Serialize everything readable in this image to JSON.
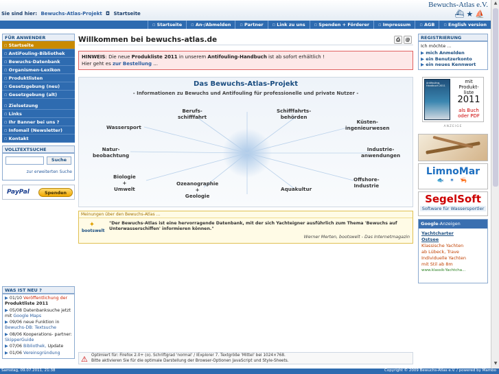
{
  "header": {
    "brand": "Bewuchs-Atlas e.V.",
    "breadcrumb_label": "Sie sind hier:",
    "breadcrumb_site": "Bewuchs-Atlas-Projekt",
    "breadcrumb_page": "Startseite"
  },
  "topnav": [
    "Startseite",
    "An-/Abmelden",
    "Partner",
    "Link zu uns",
    "Spenden + Förderer",
    "Impressum",
    "AGB",
    "English version"
  ],
  "left": {
    "heading": "FÜR ANWENDER",
    "menu": [
      "Startseite",
      "AntiFouling-Bibliothek",
      "Bewuchs-Datenbank",
      "Organismen-Lexikon",
      "Produktlisten",
      "Gesetzgebung (neu)",
      "Gesetzgebung (alt)",
      "Zielsetzung",
      "Links",
      "Ihr Banner bei uns ?",
      "Infomail (Newsletter)",
      "Kontakt"
    ],
    "search_heading": "VOLLTEXTSUCHE",
    "search_button": "Suche",
    "search_extended": "zur erweiterten Suche",
    "paypal_label": "PayPal",
    "paypal_button": "Spenden",
    "news_heading": "WAS IST NEU ?",
    "news": [
      {
        "date": "01/10",
        "text": "Veröffentlichung der",
        "bold": "Produktliste 2011"
      },
      {
        "date": "05/08",
        "text": "Datenbanksuche jetzt mit",
        "bold": "Google Maps"
      },
      {
        "date": "09/06",
        "text": "neue Funktion in",
        "bold": "Bewuchs-DB: Textsuche"
      },
      {
        "date": "08/06",
        "text": "Kooperations- partner:",
        "bold": "SkipperGuide"
      },
      {
        "date": "07/06",
        "text": "Bibliothek,",
        "bold": "Update"
      },
      {
        "date": "01/06",
        "text": "Vereinsgründung",
        "bold": ""
      }
    ]
  },
  "main": {
    "title": "Willkommen bei bewuchs-atlas.de",
    "hint_label": "HINWEIS",
    "hint_text1": ": Die neue ",
    "hint_bold1": "Produkliste 2011",
    "hint_text2": " in unserem ",
    "hint_bold2": "Antifouling-Handbuch",
    "hint_text3": " ist ab sofort erhältlich !",
    "hint_line2": "Hier geht es ",
    "hint_link": "zur Bestellung",
    "hint_after": " ...",
    "project_title": "Das Bewuchs-Atlas-Projekt",
    "project_sub": "- Informationen zu Bewuchs und Antifouling für professionelle und private Nutzer -",
    "nodes": [
      [
        "Berufs-",
        "schifffahrt"
      ],
      [
        "Schifffahrts-",
        "behörden"
      ],
      [
        "Wassersport"
      ],
      [
        "Küsten-",
        "ingenieurwesen"
      ],
      [
        "Natur-",
        "beobachtung"
      ],
      [
        "Industrie-",
        "anwendungen"
      ],
      [
        "Biologie",
        "+",
        "Umwelt"
      ],
      [
        "Offshore-",
        "Industrie"
      ],
      [
        "Ozeanographie",
        "+",
        "Geologie"
      ],
      [
        "Aquakultur"
      ]
    ],
    "quote_head": "Meinungen über den Bewuchs-Atlas ...",
    "quote_logo": "bootswelt",
    "quote_text": "\"Der Bewuchs-Atlas ist eine hervorragende Datenbank, mit der sich Yachteigner ausführlich zum Thema 'Bewuchs auf Unterwasserschiffen' informieren können.\"",
    "quote_source": "Werner Merten, bootswelt - Das Internetmagazin",
    "opt_line1": "Optimiert für: Firefox 2.0+ (o). Schriftgrad 'normal' / IExplorer 7. Textgröße 'Mittel' bei 1024×768.",
    "opt_line2": "Bitte aktivieren Sie für die optimale Darstellung der Browser-Optionen JavaScript und Style-Sheets."
  },
  "right": {
    "reg_heading": "REGISTRIERUNG",
    "reg_lead": "Ich möchte ...",
    "reg_items": [
      "mich Anmelden",
      "ein Benutzerkonto",
      "ein neues Kennwort"
    ],
    "book_cover": "Antifouling-Handbuch 2011",
    "book_mit": "mit",
    "book_l1": "Produkt-",
    "book_l2": "liste",
    "book_year": "2011",
    "book_as1": "als Buch",
    "book_as2": "oder PDF",
    "ad_label": "ANZEIGE",
    "limno": "LimnoMar",
    "limno_sub": "🐟 ✶ 🦐",
    "segel": "SegelSoft",
    "segel_sub": "Software für Wassersportler",
    "gad_brand": "Google",
    "gad_suffix": "-Anzeigen",
    "gad_t1": "Yachtcharter",
    "gad_t2": "Ostsee",
    "gad_d": [
      "Klassische Yachten",
      "ab Lübeck, Trave",
      "Individuelle Yachten",
      "mit Stil ab 8m"
    ],
    "gad_url": "www.klassik-Yachtcha..."
  },
  "footer": {
    "left": "Samstag, 09.07.2011, 21:38",
    "right": "Copyright © 2009 Bewuchs-Atlas e.V. / powered by Mambo"
  }
}
